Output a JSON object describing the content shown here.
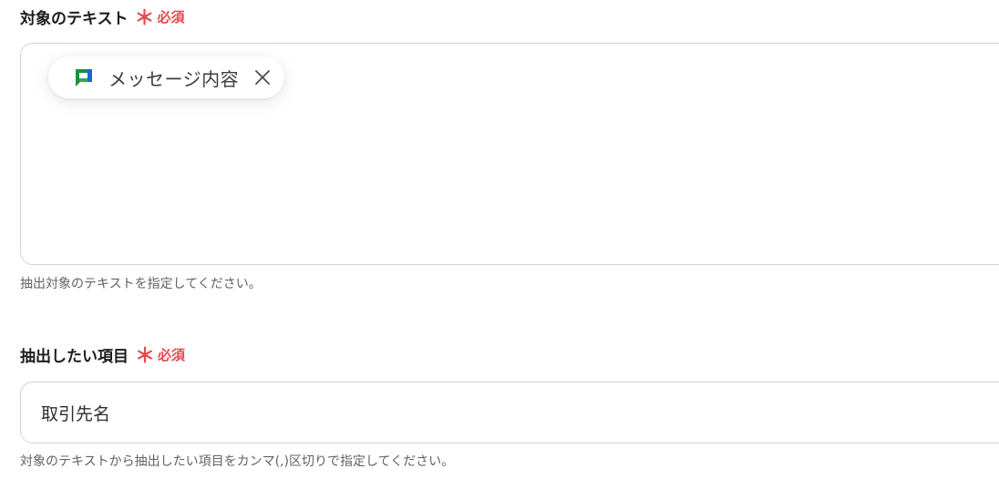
{
  "field1": {
    "label": "対象のテキスト",
    "asterisk": "＊",
    "required": "必須",
    "chip": {
      "icon": "google-chat-icon",
      "label": "メッセージ内容",
      "remove_icon": "close-icon"
    },
    "help": "抽出対象のテキストを指定してください。"
  },
  "field2": {
    "label": "抽出したい項目",
    "asterisk": "＊",
    "required": "必須",
    "value": "取引先名",
    "help": "対象のテキストから抽出したい項目をカンマ(,)区切りで指定してください。"
  },
  "colors": {
    "required": "#e5484d",
    "border": "#cfd3d8",
    "help_text": "#5f6368"
  }
}
